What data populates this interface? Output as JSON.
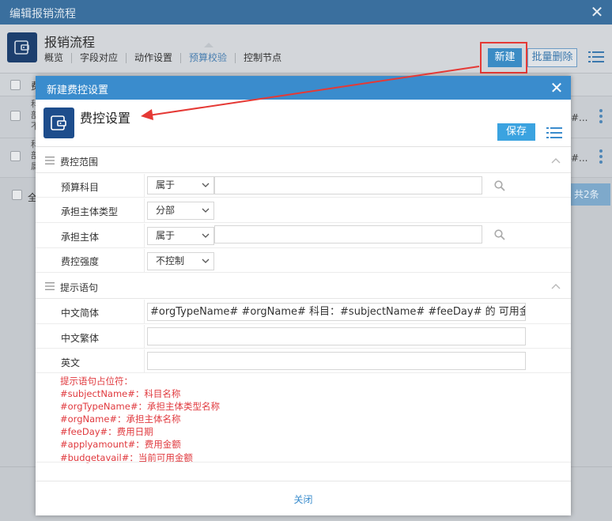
{
  "outer": {
    "title": "编辑报销流程",
    "heading": "报销流程",
    "tabs": [
      "概览",
      "字段对应",
      "动作设置",
      "预算校验",
      "控制节点"
    ],
    "active_tab": "预算校验",
    "new_button": "新建",
    "batch_delete_button": "批量删除",
    "header_col_fragment": "费",
    "row1_fragments": [
      "科",
      "部",
      "不"
    ],
    "row2_fragments": [
      "科",
      "部",
      "属"
    ],
    "row_tail": "#...",
    "select_all": "全",
    "total": "共2条"
  },
  "modal": {
    "title": "新建费控设置",
    "heading": "费控设置",
    "save_button": "保存",
    "section_scope": "费控范围",
    "fields": {
      "budget_subject": {
        "label": "预算科目",
        "operator": "属于",
        "value": ""
      },
      "entity_type": {
        "label": "承担主体类型",
        "value": "分部"
      },
      "entity": {
        "label": "承担主体",
        "operator": "属于",
        "value": ""
      },
      "strength": {
        "label": "费控强度",
        "value": "不控制"
      }
    },
    "section_prompt": "提示语句",
    "prompt": {
      "zh_simplified_label": "中文简体",
      "zh_simplified_value": "#orgTypeName# #orgName# 科目：#subjectName# #feeDay# 的 可用金额:",
      "zh_traditional_label": "中文繁体",
      "zh_traditional_value": "",
      "english_label": "英文",
      "english_value": ""
    },
    "hints": [
      "提示语句占位符：",
      "#subjectName#：科目名称",
      "#orgTypeName#：承担主体类型名称",
      "#orgName#：承担主体名称",
      "#feeDay#：费用日期",
      "#applyamount#：费用金额",
      "#budgetavail#：当前可用金额"
    ],
    "close_button": "关闭"
  },
  "colors": {
    "modal_titlebar": "#3a8ccd",
    "save_button": "#3ba3e0",
    "hint_text": "#e0393e",
    "annotation": "#e53935"
  }
}
